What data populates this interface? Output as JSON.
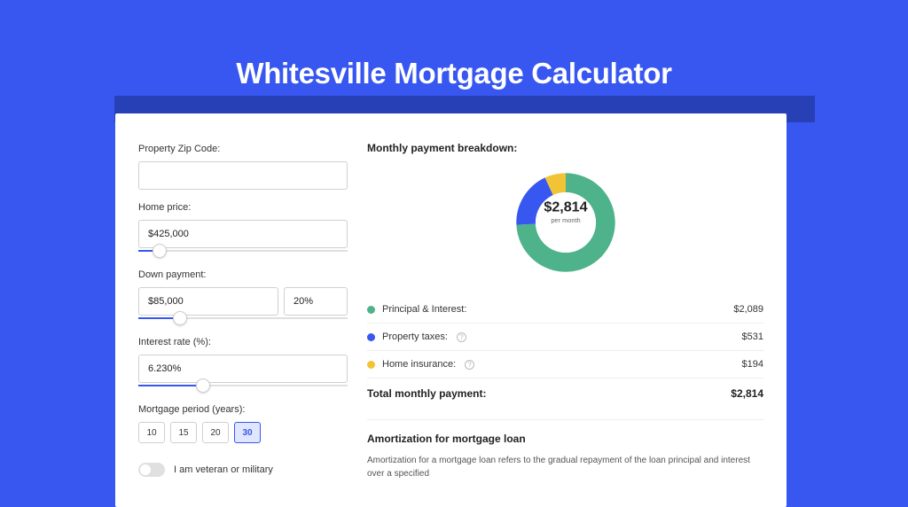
{
  "title": "Whitesville Mortgage Calculator",
  "form": {
    "zip_label": "Property Zip Code:",
    "zip_value": "",
    "home_price_label": "Home price:",
    "home_price_value": "$425,000",
    "down_payment_label": "Down payment:",
    "down_payment_value": "$85,000",
    "down_payment_pct": "20%",
    "interest_label": "Interest rate (%):",
    "interest_value": "6.230%",
    "period_label": "Mortgage period (years):",
    "periods": [
      "10",
      "15",
      "20",
      "30"
    ],
    "period_selected": "30",
    "veteran_label": "I am veteran or military"
  },
  "breakdown": {
    "title": "Monthly payment breakdown:",
    "center_amount": "$2,814",
    "center_sub": "per month",
    "items": [
      {
        "label": "Principal & Interest:",
        "value": "$2,089",
        "color": "#4eb38b",
        "num": 2089,
        "info": false
      },
      {
        "label": "Property taxes:",
        "value": "$531",
        "color": "#3757f0",
        "num": 531,
        "info": true
      },
      {
        "label": "Home insurance:",
        "value": "$194",
        "color": "#f0c435",
        "num": 194,
        "info": true
      }
    ],
    "total_label": "Total monthly payment:",
    "total_value": "$2,814"
  },
  "chart_data": {
    "type": "pie",
    "title": "Monthly payment breakdown",
    "categories": [
      "Principal & Interest",
      "Property taxes",
      "Home insurance"
    ],
    "values": [
      2089,
      531,
      194
    ],
    "colors": [
      "#4eb38b",
      "#3757f0",
      "#f0c435"
    ],
    "center_label": "$2,814 per month"
  },
  "amortization": {
    "title": "Amortization for mortgage loan",
    "text": "Amortization for a mortgage loan refers to the gradual repayment of the loan principal and interest over a specified"
  }
}
